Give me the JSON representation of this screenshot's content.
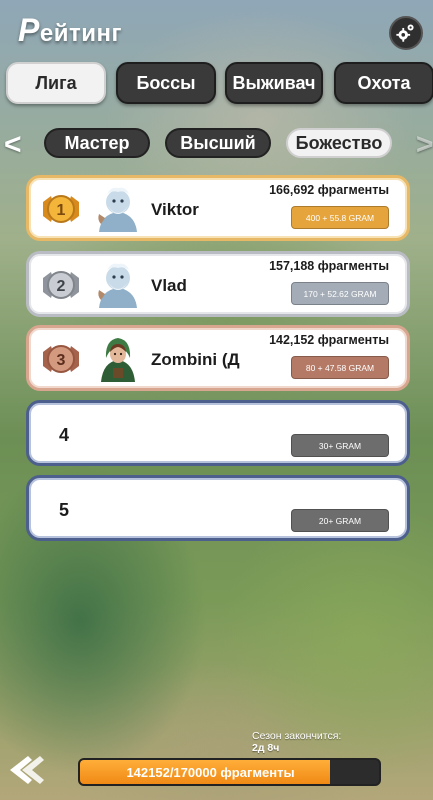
{
  "header": {
    "title_cap": "Р",
    "title_rest": "ейтинг",
    "settings_icon": "gear-icon"
  },
  "tabs": [
    {
      "label": "Лига",
      "active": true
    },
    {
      "label": "Боссы",
      "active": false
    },
    {
      "label": "Выживач",
      "active": false
    },
    {
      "label": "Охота",
      "active": false
    }
  ],
  "subtabs": [
    {
      "label": "Мастер",
      "active": false
    },
    {
      "label": "Высший",
      "active": false
    },
    {
      "label": "Божество",
      "active": true
    }
  ],
  "nav": {
    "prev": "<",
    "next": ">"
  },
  "ranking": [
    {
      "rank": "1",
      "name": "Viktor",
      "fragments": "166,692 фрагменты",
      "reward": "400 + 55.8 GRAM",
      "tier": "gold"
    },
    {
      "rank": "2",
      "name": "Vlad",
      "fragments": "157,188 фрагменты",
      "reward": "170 + 52.62 GRAM",
      "tier": "silver"
    },
    {
      "rank": "3",
      "name": "Zombini (Д",
      "fragments": "142,152 фрагменты",
      "reward": "80 + 47.58 GRAM",
      "tier": "bronze"
    },
    {
      "rank": "4",
      "name": "",
      "fragments": "",
      "reward": "30+ GRAM",
      "tier": "empty"
    },
    {
      "rank": "5",
      "name": "",
      "fragments": "",
      "reward": "20+ GRAM",
      "tier": "empty"
    }
  ],
  "footer": {
    "season_label": "Сезон закончится:",
    "season_value": "2д 8ч",
    "progress_text": "142152/170000 фрагменты",
    "progress_fraction": 0.836
  },
  "colors": {
    "gold": "#e6a43c",
    "silver": "#a4adb7",
    "bronze": "#b57a66",
    "progress": "#f08a15"
  }
}
